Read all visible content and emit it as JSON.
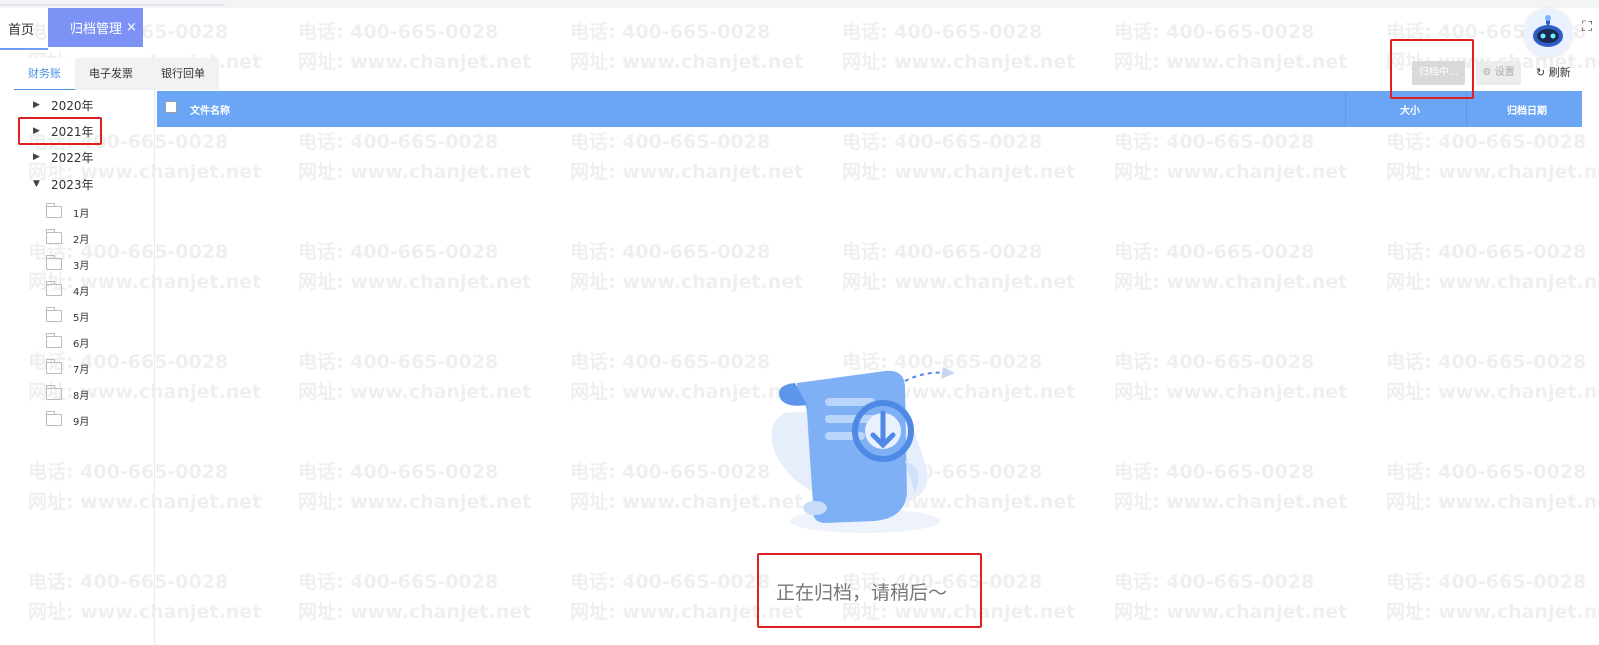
{
  "tabs": {
    "home": "首页",
    "active": "归档管理",
    "close": "×"
  },
  "sub_tabs": [
    "财务账",
    "电子发票",
    "银行回单"
  ],
  "toolbar": {
    "archiving": "归档中...",
    "settings": "设置",
    "refresh": "刷新"
  },
  "tree": {
    "years": [
      "2020年",
      "2021年",
      "2022年",
      "2023年"
    ],
    "months": [
      "1月",
      "2月",
      "3月",
      "4月",
      "5月",
      "6月",
      "7月",
      "8月",
      "9月"
    ]
  },
  "table": {
    "col_name": "文件名称",
    "col_size": "大小",
    "col_date": "归档日期"
  },
  "watermark": {
    "phone": "电话: 400-665-0028",
    "site": "网址: www.chanjet.net"
  },
  "status_text": "正在归档，请稍后～",
  "colors": {
    "header_blue": "#6aa6f5",
    "tab_active": "#7c92f5",
    "annotation_red": "#e02020"
  }
}
